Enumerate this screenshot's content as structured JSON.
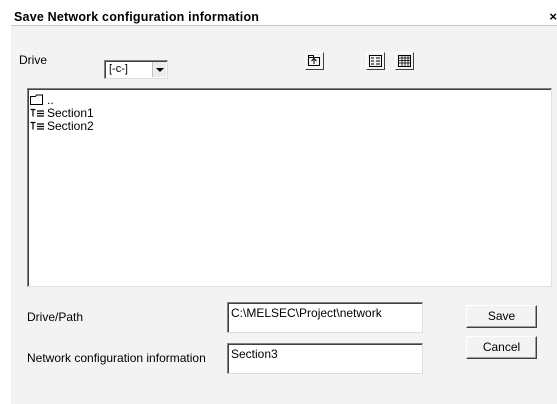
{
  "dialog": {
    "title": "Save Network configuration information",
    "close_label": "×"
  },
  "drive": {
    "label": "Drive",
    "selected": "[-c-]"
  },
  "toolbar": {
    "icons": [
      "up-folder-icon",
      "list-view-icon",
      "details-view-icon"
    ]
  },
  "file_list": {
    "items": [
      {
        "icon": "folder-icon",
        "label": ".."
      },
      {
        "icon": "network-section-icon",
        "label": "Section1"
      },
      {
        "icon": "network-section-icon",
        "label": "Section2"
      }
    ]
  },
  "form": {
    "drive_path_label": "Drive/Path",
    "drive_path_value": "C:\\MELSEC\\Project\\network",
    "network_info_label": "Network configuration information",
    "network_info_value": "Section3"
  },
  "buttons": {
    "save": "Save",
    "cancel": "Cancel"
  }
}
